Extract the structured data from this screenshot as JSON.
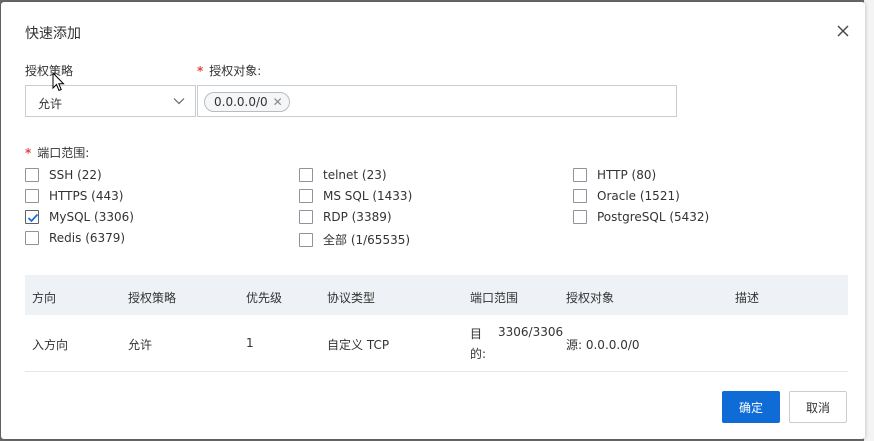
{
  "dialog": {
    "title": "快速添加"
  },
  "form": {
    "policy_label": "授权策略",
    "policy_value": "允许",
    "target_label": "授权对象:",
    "target_tags": [
      "0.0.0.0/0"
    ],
    "port_label": "端口范围:",
    "ports": [
      {
        "label": "SSH (22)",
        "checked": false
      },
      {
        "label": "telnet (23)",
        "checked": false
      },
      {
        "label": "HTTP (80)",
        "checked": false
      },
      {
        "label": "HTTPS (443)",
        "checked": false
      },
      {
        "label": "MS SQL (1433)",
        "checked": false
      },
      {
        "label": "Oracle (1521)",
        "checked": false
      },
      {
        "label": "MySQL (3306)",
        "checked": true
      },
      {
        "label": "RDP (3389)",
        "checked": false
      },
      {
        "label": "PostgreSQL (5432)",
        "checked": false
      },
      {
        "label": "Redis (6379)",
        "checked": false
      },
      {
        "label": "全部 (1/65535)",
        "checked": false
      }
    ]
  },
  "table": {
    "headers": [
      "方向",
      "授权策略",
      "优先级",
      "协议类型",
      "端口范围",
      "授权对象",
      "描述"
    ],
    "rows": [
      {
        "direction": "入方向",
        "policy": "允许",
        "priority": "1",
        "protocol": "自定义 TCP",
        "port_prefix_1": "目",
        "port_prefix_2": "的:",
        "port_value": "3306/3306",
        "target": "源: 0.0.0.0/0",
        "description": ""
      }
    ]
  },
  "buttons": {
    "confirm": "确定",
    "cancel": "取消"
  },
  "colors": {
    "primary": "#0f6bd6",
    "required": "#e54545",
    "table_header_bg": "#eef1f5"
  }
}
